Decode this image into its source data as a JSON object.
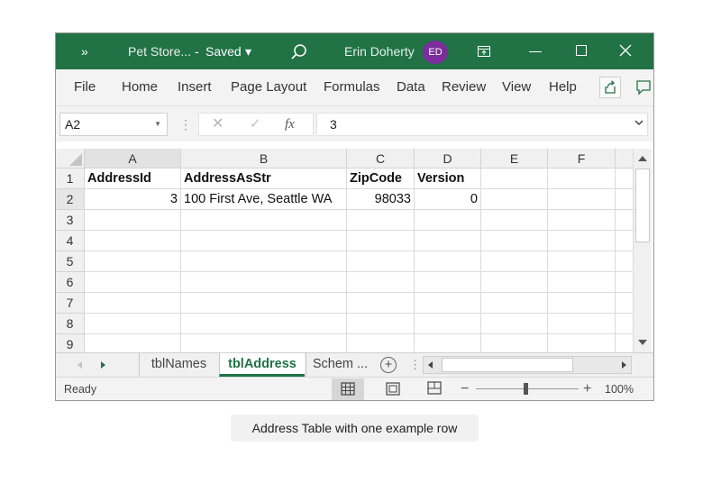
{
  "titlebar": {
    "chevron": "»",
    "file_name": "Pet Store...",
    "separator": "-",
    "saved_label": "Saved",
    "caret": "▾",
    "user_name": "Erin Doherty",
    "user_initials": "ED"
  },
  "ribbon": {
    "tabs": [
      {
        "label": "File"
      },
      {
        "label": "Home"
      },
      {
        "label": "Insert"
      },
      {
        "label": "Page Layout"
      },
      {
        "label": "Formulas"
      },
      {
        "label": "Data"
      },
      {
        "label": "Review"
      },
      {
        "label": "View"
      },
      {
        "label": "Help"
      }
    ]
  },
  "formula_bar": {
    "name_box": "A2",
    "dots": "⋮",
    "cancel_symbol": "✕",
    "enter_symbol": "✓",
    "fx_label": "fx",
    "value": "3"
  },
  "sheet": {
    "columns": [
      "A",
      "B",
      "C",
      "D",
      "E",
      "F"
    ],
    "rows": [
      "1",
      "2",
      "3",
      "4",
      "5",
      "6",
      "7",
      "8",
      "9"
    ],
    "selected_cell": "A2",
    "header_row": [
      "AddressId",
      "AddressAsStr",
      "ZipCode",
      "Version",
      "",
      ""
    ],
    "data_row": [
      "3",
      "100 First Ave, Seattle WA",
      "98033",
      "0",
      "",
      ""
    ]
  },
  "sheet_tabs": {
    "tabs": [
      {
        "label": "tblNames",
        "active": false
      },
      {
        "label": "tblAddress",
        "active": true
      },
      {
        "label": "Schem ...",
        "active": false
      }
    ],
    "add_symbol": "+",
    "more_symbol": "⋮"
  },
  "statusbar": {
    "status": "Ready",
    "zoom_minus": "−",
    "zoom_plus": "+",
    "zoom_level": "100%"
  },
  "caption": "Address Table with one example row",
  "colors": {
    "brand": "#217346",
    "avatar": "#7a2d9b"
  }
}
